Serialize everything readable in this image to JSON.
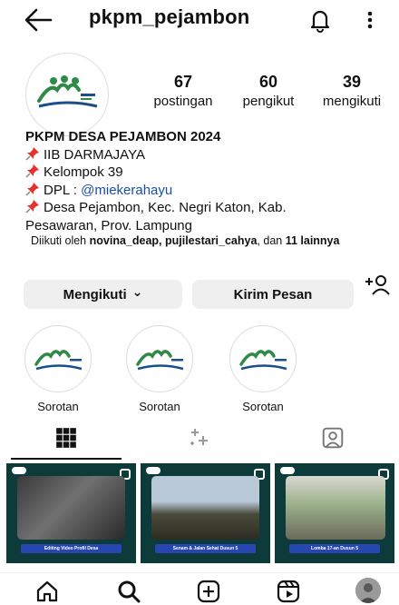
{
  "header": {
    "username": "pkpm_pejambon",
    "back_icon": "back-arrow-icon",
    "bell_icon": "bell-icon",
    "more_icon": "more-vertical-icon"
  },
  "profile": {
    "avatar_icon": "profile-logo",
    "stats": [
      {
        "value": "67",
        "label": "postingan"
      },
      {
        "value": "60",
        "label": "pengikut"
      },
      {
        "value": "39",
        "label": "mengikuti"
      }
    ],
    "name": "PKPM DESA PEJAMBON 2024",
    "bio_lines": [
      {
        "text": "IIB DARMAJAYA"
      },
      {
        "text": "Kelompok 39"
      },
      {
        "prefix": "DPL : ",
        "mention": "@miekerahayu"
      },
      {
        "text": "Desa Pejambon, Kec. Negri Katon, Kab."
      }
    ],
    "bio_continuation": "Pesawaran, Prov. Lampung",
    "followed_by": {
      "prefix": "Diikuti oleh ",
      "users": "novina_deap, pujilestari_cahya",
      "middle": ", dan ",
      "count": "11 lainnya"
    }
  },
  "actions": {
    "follow_label": "Mengikuti",
    "follow_chevron": "⌄",
    "message_label": "Kirim Pesan",
    "add_person_icon": "add-person-icon"
  },
  "highlights": [
    {
      "label": "Sorotan"
    },
    {
      "label": "Sorotan"
    },
    {
      "label": "Sorotan"
    }
  ],
  "tabs": [
    {
      "icon": "grid-icon",
      "active": true
    },
    {
      "icon": "reels-sparkle-icon",
      "active": false
    },
    {
      "icon": "tagged-icon",
      "active": false
    }
  ],
  "posts": [
    {
      "caption": "Editing Video Profil Desa"
    },
    {
      "caption": "Senam & Jalan Sehat Dusun 5"
    },
    {
      "caption": "Lomba 17-an Dusun 5"
    }
  ],
  "bottom_nav": [
    "home-icon",
    "search-icon",
    "create-icon",
    "reels-icon",
    "profile-avatar"
  ],
  "colors": {
    "mention": "#1a4fa8",
    "button_bg": "#efefef",
    "post_bg": "#0c3b3a",
    "caption_bg": "#2746b0"
  }
}
